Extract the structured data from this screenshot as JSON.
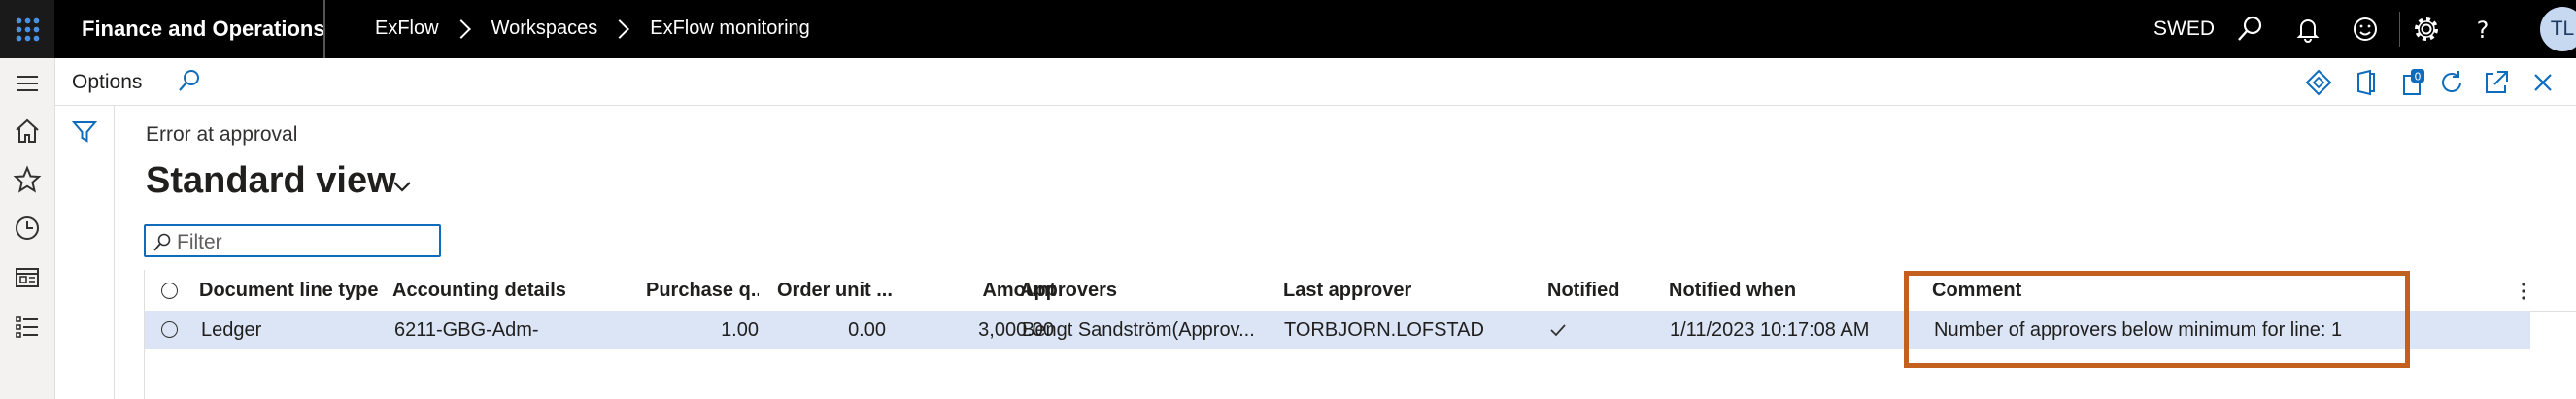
{
  "topbar": {
    "app_name": "Finance and Operations",
    "breadcrumbs": [
      "ExFlow",
      "Workspaces",
      "ExFlow monitoring"
    ],
    "company": "SWED",
    "user_initials": "TL",
    "icons": [
      "search-icon",
      "bell-icon",
      "smiley-icon",
      "gear-icon",
      "help-icon"
    ]
  },
  "leftnav": {
    "icons": [
      "hamburger-icon",
      "home-icon",
      "star-icon",
      "clock-icon",
      "workspace-icon",
      "list-icon"
    ]
  },
  "options": {
    "label": "Options",
    "icons": [
      "diamond-icon",
      "office-icon",
      "attachments-icon",
      "refresh-icon",
      "popout-icon",
      "close-icon"
    ],
    "attachments_count": "0"
  },
  "view": {
    "caption": "Error at approval",
    "title": "Standard view",
    "filter_placeholder": "Filter"
  },
  "grid": {
    "columns": [
      "Document line type",
      "Accounting details",
      "Purchase q...",
      "Order unit ...",
      "Amount",
      "Approvers",
      "Last approver",
      "Notified",
      "Notified when",
      "Comment"
    ],
    "rows": [
      {
        "document_line_type": "Ledger",
        "accounting_details": "6211-GBG-Adm-",
        "purchase_qty": "1.00",
        "order_unit": "0.00",
        "amount": "3,000.00",
        "approvers": "Bengt Sandström(Approv...",
        "last_approver": "TORBJORN.LOFSTAD",
        "notified": true,
        "notified_when": "1/11/2023 10:17:08 AM",
        "comment": "Number of approvers below minimum for line: 1"
      }
    ]
  },
  "colors": {
    "accent": "#0f6cbd",
    "highlight_box": "#c4601d",
    "selected_row": "#dbe5f5",
    "topbar": "#000000"
  }
}
